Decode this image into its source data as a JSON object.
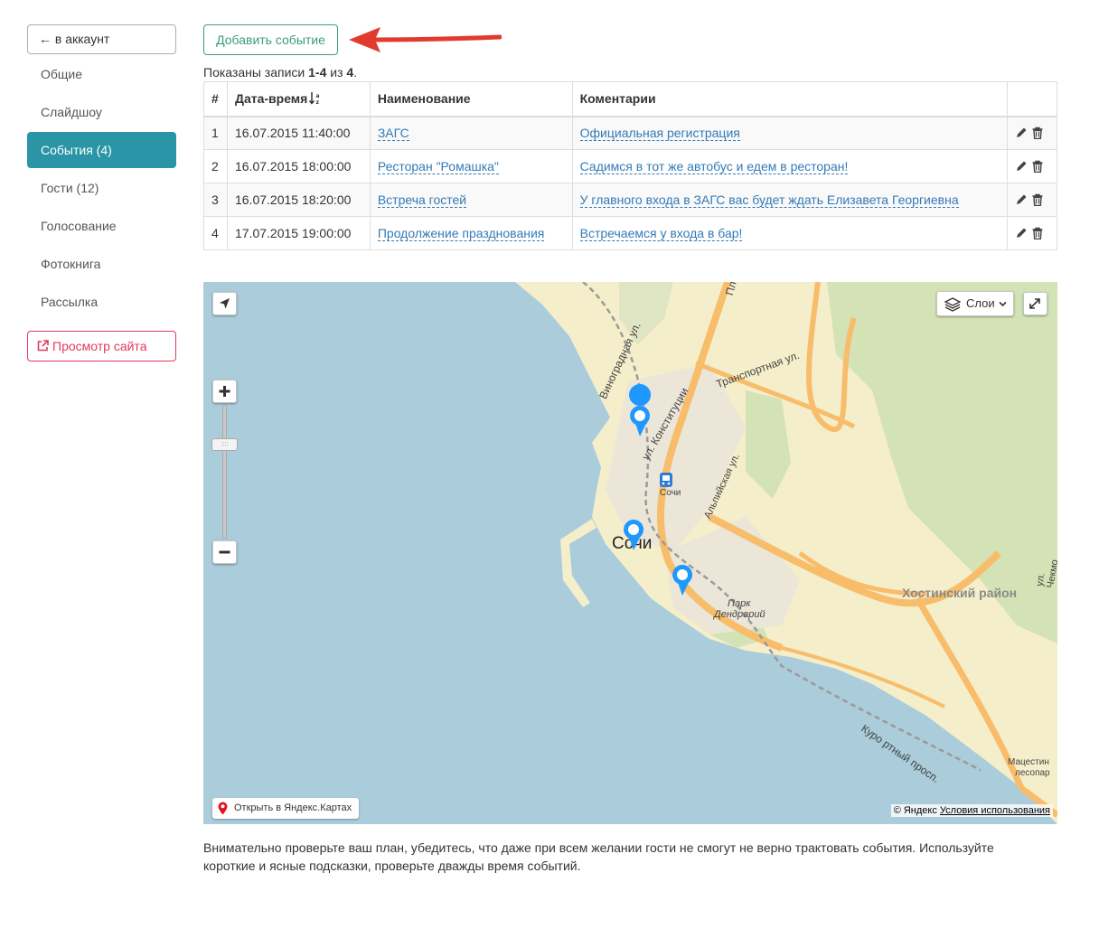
{
  "sidebar": {
    "back_label": "← в аккаунт",
    "items": [
      {
        "label": "Общие",
        "active": false
      },
      {
        "label": "Слайдшоу",
        "active": false
      },
      {
        "label": "События (4)",
        "active": true
      },
      {
        "label": "Гости (12)",
        "active": false
      },
      {
        "label": "Голосование",
        "active": false
      },
      {
        "label": "Фотокнига",
        "active": false
      },
      {
        "label": "Рассылка",
        "active": false
      }
    ],
    "preview_label": "Просмотр сайта"
  },
  "toolbar": {
    "add_label": "Добавить событие"
  },
  "summary": {
    "prefix": "Показаны записи ",
    "range": "1-4",
    "middle": " из ",
    "total": "4",
    "suffix": "."
  },
  "table": {
    "headers": {
      "num": "#",
      "datetime": "Дата-время",
      "name": "Наименование",
      "comment": "Коментарии"
    },
    "rows": [
      {
        "num": "1",
        "datetime": "16.07.2015 11:40:00",
        "name": "ЗАГС",
        "comment": "Официальная регистрация"
      },
      {
        "num": "2",
        "datetime": "16.07.2015 18:00:00",
        "name": "Ресторан \"Ромашка\"",
        "comment": "Садимся в тот же автобус и едем в ресторан!"
      },
      {
        "num": "3",
        "datetime": "16.07.2015 18:20:00",
        "name": "Встреча гостей",
        "comment": "У главного входа в ЗАГС вас будет ждать Елизавета Георгиевна"
      },
      {
        "num": "4",
        "datetime": "17.07.2015 19:00:00",
        "name": "Продолжение празднования",
        "comment": "Встречаемся у входа в бар!"
      }
    ]
  },
  "map": {
    "layers_label": "Слои",
    "open_label": "Открыть в Яндекс.Картах",
    "copyright": "© Яндекс",
    "terms": "Условия использования",
    "labels": {
      "city": "Сочи",
      "district": "Хостинский район",
      "street1": "Транспортная ул.",
      "street2": "ул. Конституции",
      "street3": "Виноградная ул.",
      "street4": "Альпийская ул.",
      "park": "Парк",
      "park2": "Дендрарий",
      "station": "Сочи",
      "avenue": "Куро  ртный просп.",
      "forest1": "Мацестин",
      "forest2": "лесопар",
      "road_edge": "ул. Чекмо",
      "road_top": "Пл"
    },
    "colors": {
      "water": "#aaccdb",
      "land": "#f5eeca",
      "green": "#d4e3b5",
      "road": "#f7bd6b",
      "marker": "#1e98ff"
    }
  },
  "note": "Внимательно проверьте ваш план, убедитесь, что даже при всем желании гости не смогут не верно трактовать события. Используйте короткие и ясные подсказки, проверьте дважды время событий."
}
